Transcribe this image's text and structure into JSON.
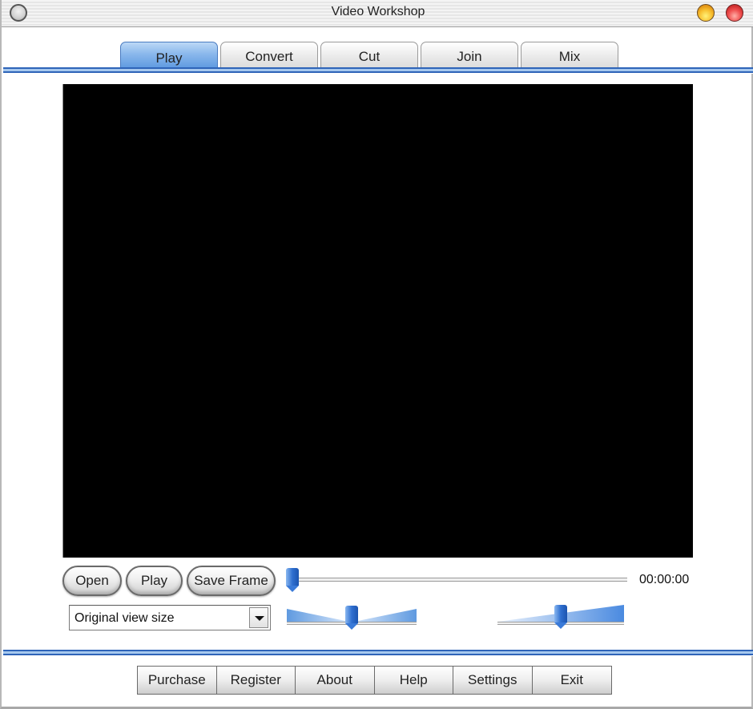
{
  "window": {
    "title": "Video Workshop"
  },
  "tabs": [
    {
      "label": "Play",
      "active": true
    },
    {
      "label": "Convert",
      "active": false
    },
    {
      "label": "Cut",
      "active": false
    },
    {
      "label": "Join",
      "active": false
    },
    {
      "label": "Mix",
      "active": false
    }
  ],
  "controls": {
    "open_label": "Open",
    "play_label": "Play",
    "save_frame_label": "Save Frame",
    "position_fraction": 0.0,
    "time": "00:00:00",
    "view_size": "Original view size",
    "balance_fraction": 0.5,
    "volume_fraction": 0.5
  },
  "bottom_buttons": [
    {
      "label": "Purchase"
    },
    {
      "label": "Register"
    },
    {
      "label": "About"
    },
    {
      "label": "Help"
    },
    {
      "label": "Settings"
    },
    {
      "label": "Exit"
    }
  ],
  "colors": {
    "accent": "#2e64b8",
    "active_tab": "#8ab8ec",
    "video_bg": "#000000"
  }
}
